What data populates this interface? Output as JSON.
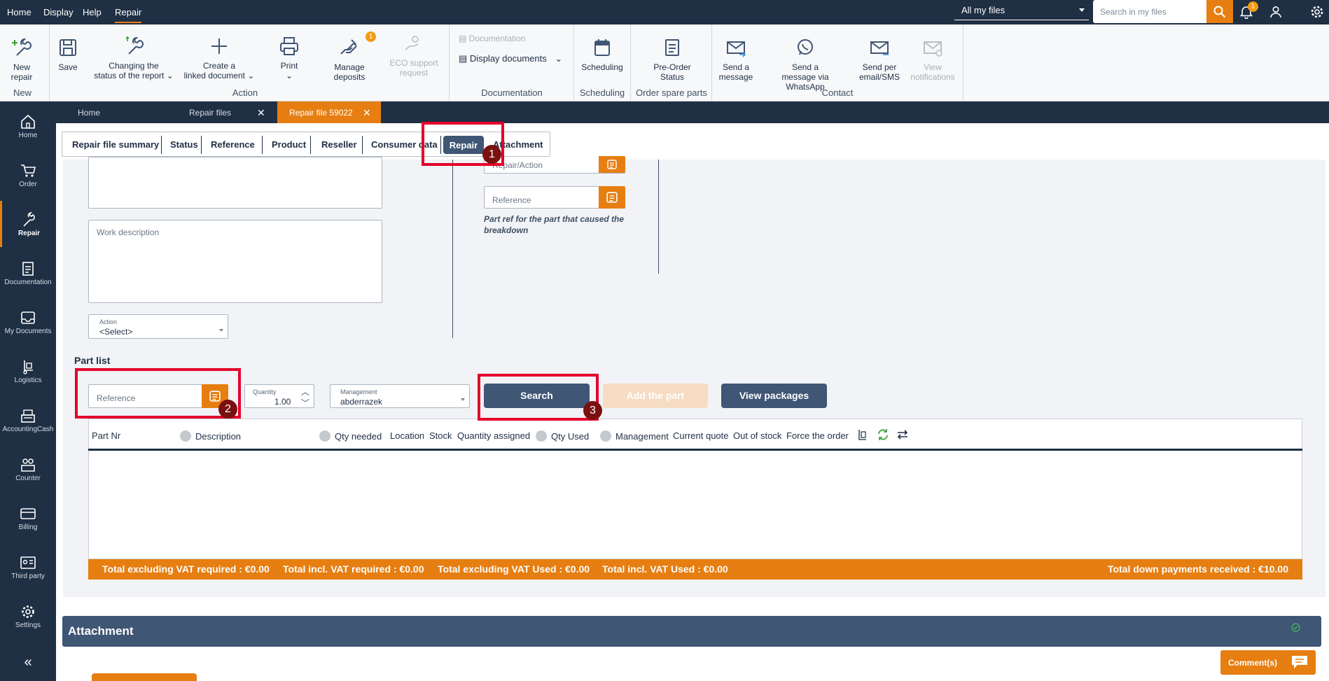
{
  "menu": {
    "home": "Home",
    "display": "Display",
    "help": "Help",
    "repair": "Repair"
  },
  "file_filter": "All my files",
  "search": {
    "placeholder": "Search in my files"
  },
  "notifications_count": "1",
  "ribbon": {
    "new_repair": [
      "New",
      "repair"
    ],
    "save": "Save",
    "changing_status": [
      "Changing the",
      "status of the report"
    ],
    "create_linked": [
      "Create a",
      "linked document"
    ],
    "print": "Print",
    "manage_deposits": [
      "Manage",
      "deposits"
    ],
    "deposits_badge": "1",
    "eco_support": [
      "ECO support",
      "request"
    ],
    "documentation_small": "Documentation",
    "display_documents": "Display documents",
    "scheduling": "Scheduling",
    "pre_order": [
      "Pre-Order",
      "Status"
    ],
    "send_message": [
      "Send a",
      "message"
    ],
    "send_whatsapp": [
      "Send a",
      "message via WhatsApp"
    ],
    "send_email_sms": [
      "Send per",
      "email/SMS"
    ],
    "view_notifications": [
      "View",
      "notifications"
    ],
    "groups": {
      "new": "New",
      "action": "Action",
      "documentation": "Documentation",
      "scheduling": "Scheduling",
      "order_spare_parts": "Order spare parts",
      "contact": "Contact"
    }
  },
  "sidebar": [
    "Home",
    "Order",
    "Repair",
    "Documentation",
    "My Documents",
    "Logistics",
    "AccountingCash",
    "Counter",
    "Billing",
    "Third party",
    "Settings"
  ],
  "window_tabs": [
    "Home",
    "Repair files",
    "Repair file 59022"
  ],
  "subtabs": [
    "Repair file summary",
    "Status",
    "Reference",
    "Product",
    "Reseller",
    "Consumer data",
    "Repair",
    "Attachment"
  ],
  "markers": [
    "1",
    "2",
    "3"
  ],
  "form": {
    "work_description": "Work description",
    "action_label": "Action",
    "action_value": "<Select>",
    "repair_action": "Repair/Action",
    "reference": "Reference",
    "part_ref_hint": "Part ref for the part that caused the breakdown"
  },
  "part_list": {
    "title": "Part list",
    "reference_placeholder": "Reference",
    "quantity_label": "Quantity",
    "quantity_value": "1.00",
    "management_label": "Management",
    "management_value": "abderrazek",
    "search_button": "Search",
    "add_part_button": "Add the part",
    "view_packages_button": "View packages",
    "columns": [
      "Part Nr",
      "Description",
      "Qty needed",
      "Location",
      "Stock",
      "Quantity assigned",
      "Qty Used",
      "Management",
      "Current quote",
      "Out of stock",
      "Force the order"
    ]
  },
  "totals": {
    "excl_vat_required": "Total excluding VAT required : €0.00",
    "incl_vat_required": "Total incl. VAT required : €0.00",
    "excl_vat_used": "Total excluding VAT Used : €0.00",
    "incl_vat_used": "Total incl. VAT Used : €0.00",
    "down_payments": "Total down payments received : €10.00"
  },
  "attachment_title": "Attachment",
  "comments_button": "Comment(s)",
  "colors": {
    "navy": "#1f2f44",
    "orange": "#e67e11",
    "slate": "#3f5675",
    "red_highlight": "#e4002b"
  }
}
